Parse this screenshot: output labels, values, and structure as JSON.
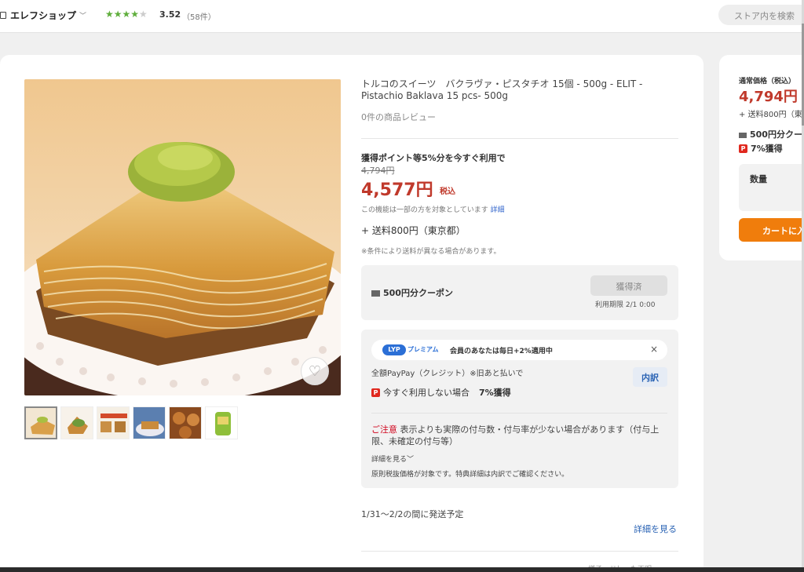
{
  "header": {
    "store_name": "エレフショップ",
    "rating_value": "3.52",
    "rating_count": "（58件）",
    "rating_stars": 3.5,
    "search_placeholder": "ストア内を検索"
  },
  "product": {
    "title": "トルコのスイーツ　バクラヴァ・ピスタチオ 15個 - 500g - ELIT - Pistachio Baklava 15 pcs- 500g",
    "reviews": "0件の商品レビュー",
    "points_line": "獲得ポイント等5%分を今すぐ利用で",
    "old_price": "4,794円",
    "price": "4,577円",
    "tax_label": "税込",
    "note": "この機能は一部の方を対象としています",
    "note_link": "詳細",
    "shipping": "+ 送料800円（東京都）",
    "shipping_note": "※条件により送料が異なる場合があります。"
  },
  "coupon": {
    "label": "500円分クーポン",
    "button": "獲得済",
    "expiry": "利用期限 2/1 0:00"
  },
  "paypay": {
    "lyp_logo": "LYP",
    "lyp_premium": "プレミアム",
    "lyp_text": "会員のあなたは毎日+2%適用中",
    "close": "×",
    "method": "全額PayPay（クレジット）※旧あと払いで",
    "breakdown_button": "内訳",
    "earn_label": "今すぐ利用しない場合",
    "earn_value": "7%獲得",
    "badge": "P",
    "caution_label": "ご注意",
    "caution_text": "表示よりも実際の付与数・付与率が少ない場合があります（付与上限、未確定の付与等）",
    "more": "詳細を見る",
    "rule": "原則税抜価格が対象です。特典詳細は内訳でご確認ください。"
  },
  "delivery": {
    "text": "1/31〜2/2の間に発送予定",
    "link": "詳細を見る",
    "cut_text": "…様子・ドし…も不明…"
  },
  "sidebar": {
    "regular_price_label": "通常価格（税込）",
    "regular_price": "4,794円",
    "shipping": "+ 送料800円（東",
    "coupon": "500円分クー",
    "points": "7%獲得",
    "qty_label": "数量",
    "cart_button": "カートに入"
  },
  "icons": {
    "heart": "heart-icon",
    "chevron": "chevron-down-icon",
    "store": "store-icon"
  }
}
